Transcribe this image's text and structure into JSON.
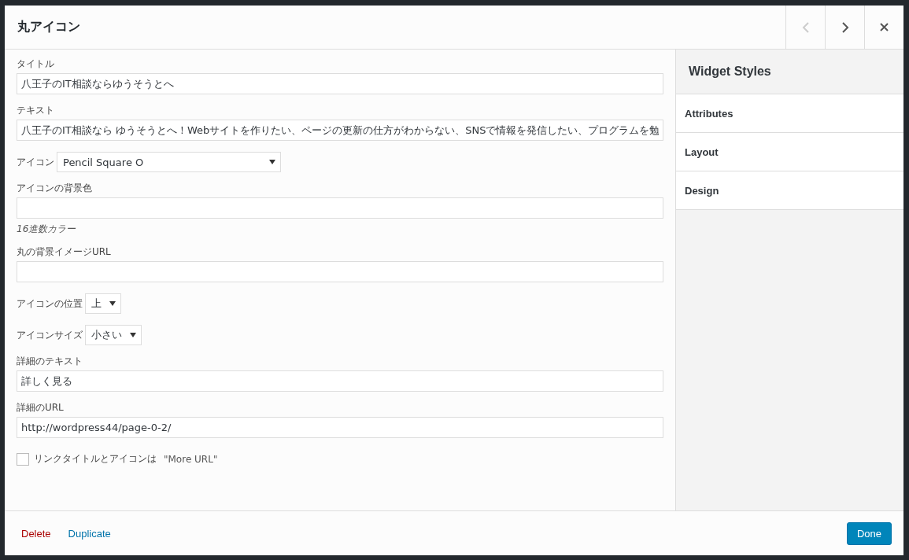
{
  "dialog": {
    "title": "丸アイコン",
    "nav": [
      {
        "kind": "prev",
        "disabled": true
      },
      {
        "kind": "next",
        "disabled": false
      },
      {
        "kind": "close",
        "disabled": false
      }
    ]
  },
  "form": {
    "fields": [
      {
        "kind": "text",
        "label": "タイトル",
        "value": "八王子のIT相談ならゆうそうとへ"
      },
      {
        "kind": "text",
        "label": "テキスト",
        "value": "八王子のIT相談なら ゆうそうとへ！Webサイトを作りたい、ページの更新の仕方がわからない、SNSで情報を発信したい、プログラムを勉"
      },
      {
        "kind": "select",
        "label": "アイコン",
        "value": "Pencil Square O",
        "wide": true
      },
      {
        "kind": "text",
        "label": "アイコンの背景色",
        "hint": "16進数カラー"
      },
      {
        "kind": "text",
        "label": "丸の背景イメージURL"
      },
      {
        "kind": "select",
        "label": "アイコンの位置",
        "value": "上",
        "wide": false
      },
      {
        "kind": "select",
        "label": "アイコンサイズ",
        "value": "小さい",
        "wide": false
      },
      {
        "kind": "text",
        "label": "詳細のテキスト",
        "value": "詳しく見る"
      },
      {
        "kind": "text",
        "label": "詳細のURL",
        "value": "http://wordpress44/page-0-2/"
      },
      {
        "kind": "checkbox",
        "label": "リンクタイトルとアイコンは",
        "note": "\"More URL\"",
        "checked": false
      }
    ]
  },
  "sidebar": {
    "title": "Widget Styles",
    "sections": [
      "Attributes",
      "Layout",
      "Design"
    ]
  },
  "footer": {
    "links": [
      {
        "kind": "danger",
        "label": "Delete"
      },
      {
        "kind": "normal",
        "label": "Duplicate"
      }
    ],
    "primary": "Done"
  }
}
